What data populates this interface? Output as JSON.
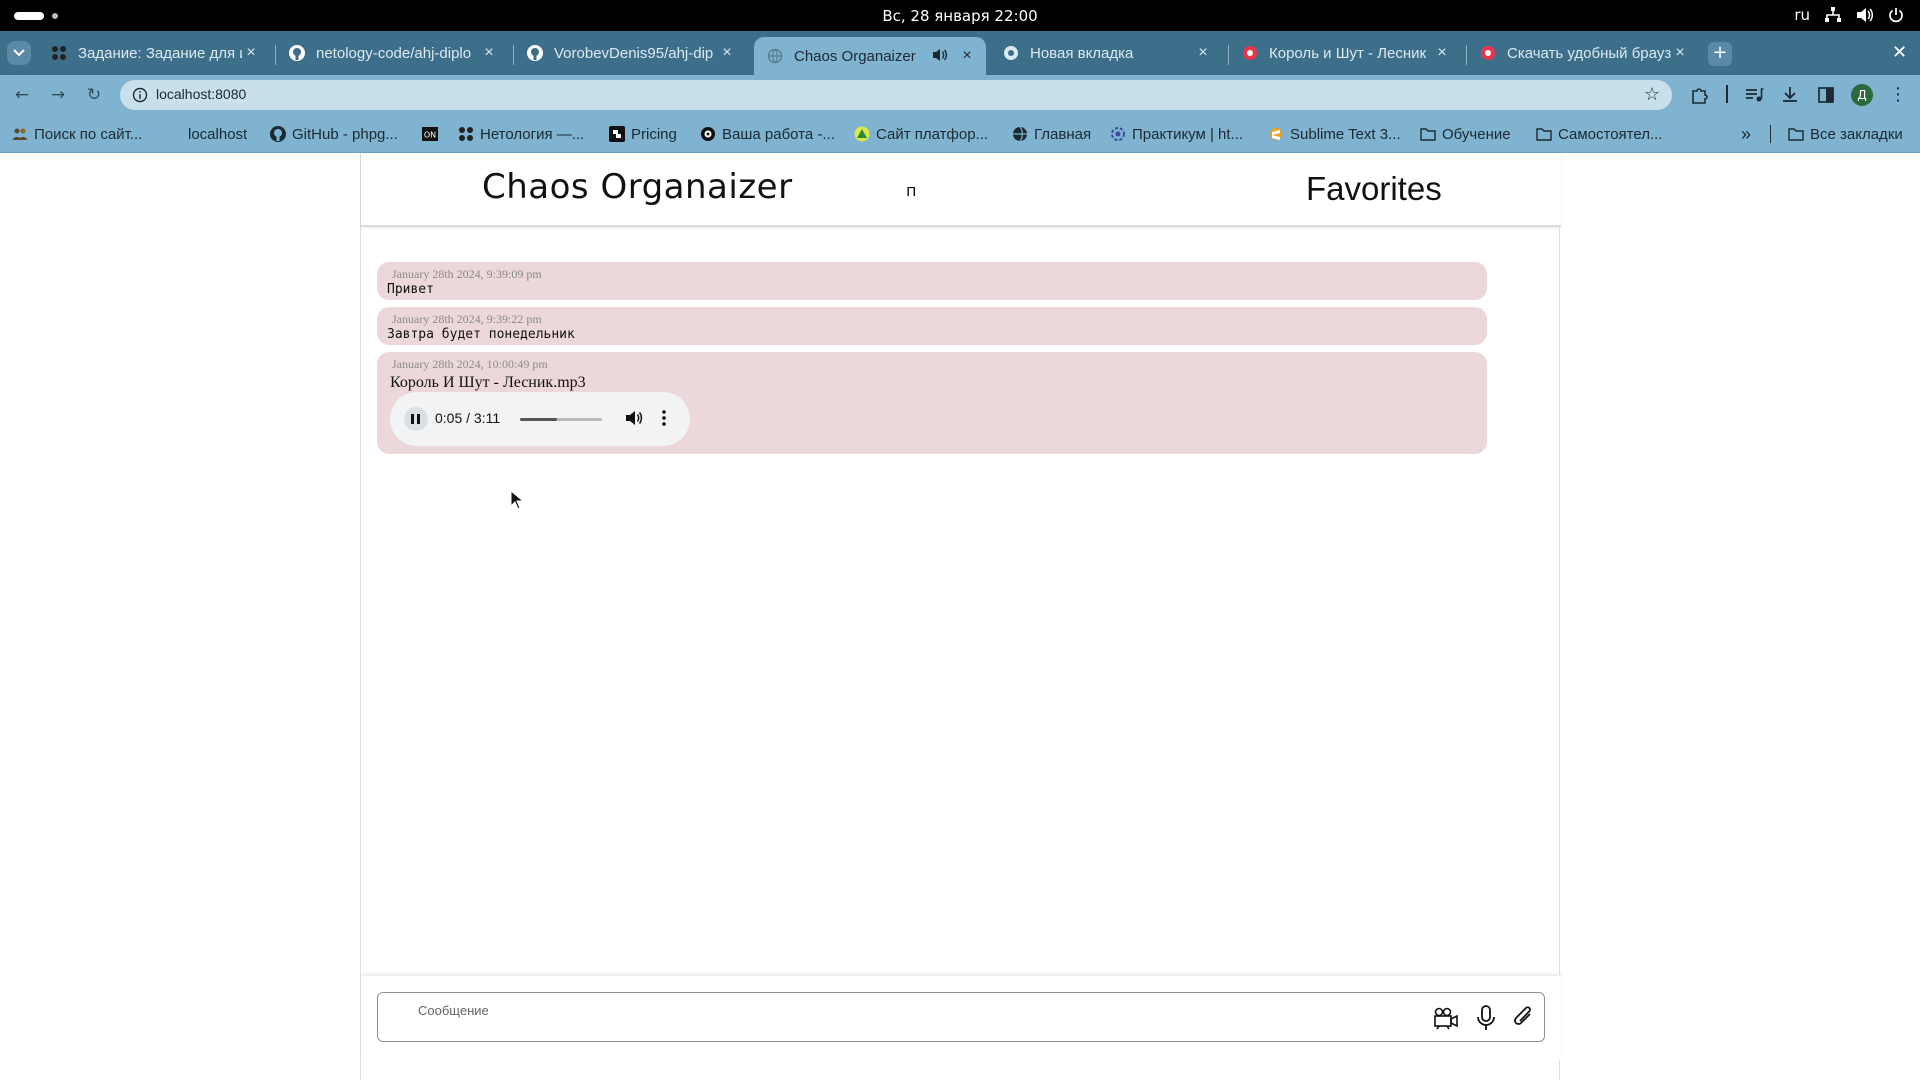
{
  "system": {
    "clock": "Вс, 28 января  22:00",
    "lang": "ru"
  },
  "tabs": [
    {
      "title": "Задание: Задание для и",
      "favicon": "netology-icon",
      "active": false
    },
    {
      "title": "netology-code/ahj-diplo",
      "favicon": "github-icon",
      "active": false
    },
    {
      "title": "VorobevDenis95/ahj-dip",
      "favicon": "github-icon",
      "active": false
    },
    {
      "title": "Chaos Organaizer",
      "favicon": "globe-icon",
      "active": true,
      "audio": true
    },
    {
      "title": "Новая вкладка",
      "favicon": "chrome-icon",
      "active": false
    },
    {
      "title": "Король и Шут - Лесник",
      "favicon": "red-record-icon",
      "active": false
    },
    {
      "title": "Скачать удобный брауз",
      "favicon": "red-record-icon",
      "active": false
    }
  ],
  "toolbar": {
    "url": "localhost:8080",
    "profile_initial": "Д"
  },
  "bookmarks": [
    {
      "label": "Поиск по сайт...",
      "icon": "people-icon"
    },
    {
      "label": "localhost",
      "icon": "none"
    },
    {
      "label": "GitHub - phpg...",
      "icon": "github-icon"
    },
    {
      "label": "",
      "icon": "on-icon"
    },
    {
      "label": "Нетология —...",
      "icon": "netology-icon"
    },
    {
      "label": "Pricing",
      "icon": "pricing-icon"
    },
    {
      "label": "Ваша работа -...",
      "icon": "gear-icon"
    },
    {
      "label": "Сайт платфор...",
      "icon": "triangle-icon"
    },
    {
      "label": "Главная",
      "icon": "globe-icon"
    },
    {
      "label": "Практикум | ht...",
      "icon": "practicum-icon"
    },
    {
      "label": "Sublime Text 3...",
      "icon": "sublime-icon"
    },
    {
      "label": "Обучение",
      "icon": "folder-icon"
    },
    {
      "label": "Самостоятел...",
      "icon": "folder-icon"
    }
  ],
  "bookmarks_all": "Все закладки",
  "app": {
    "title": "Chaos Organaizer",
    "mid": "п",
    "favorites": "Favorites",
    "messages": [
      {
        "timestamp": "January 28th 2024, 9:39:09 pm",
        "text": "Привет",
        "type": "text"
      },
      {
        "timestamp": "January 28th 2024, 9:39:22 pm",
        "text": "Завтра будет понедельник",
        "type": "text"
      },
      {
        "timestamp": "January 28th 2024, 10:00:49 pm",
        "text": "Король И Шут - Лесник.mp3",
        "type": "audio",
        "player": {
          "time": "0:05 / 3:11",
          "progress": 0.45
        }
      }
    ],
    "input_placeholder": "Сообщение"
  },
  "colors": {
    "tabstrip": "#3e6f8a",
    "toolbar": "#7fb3d0",
    "message_bg": "#ecd8da"
  }
}
